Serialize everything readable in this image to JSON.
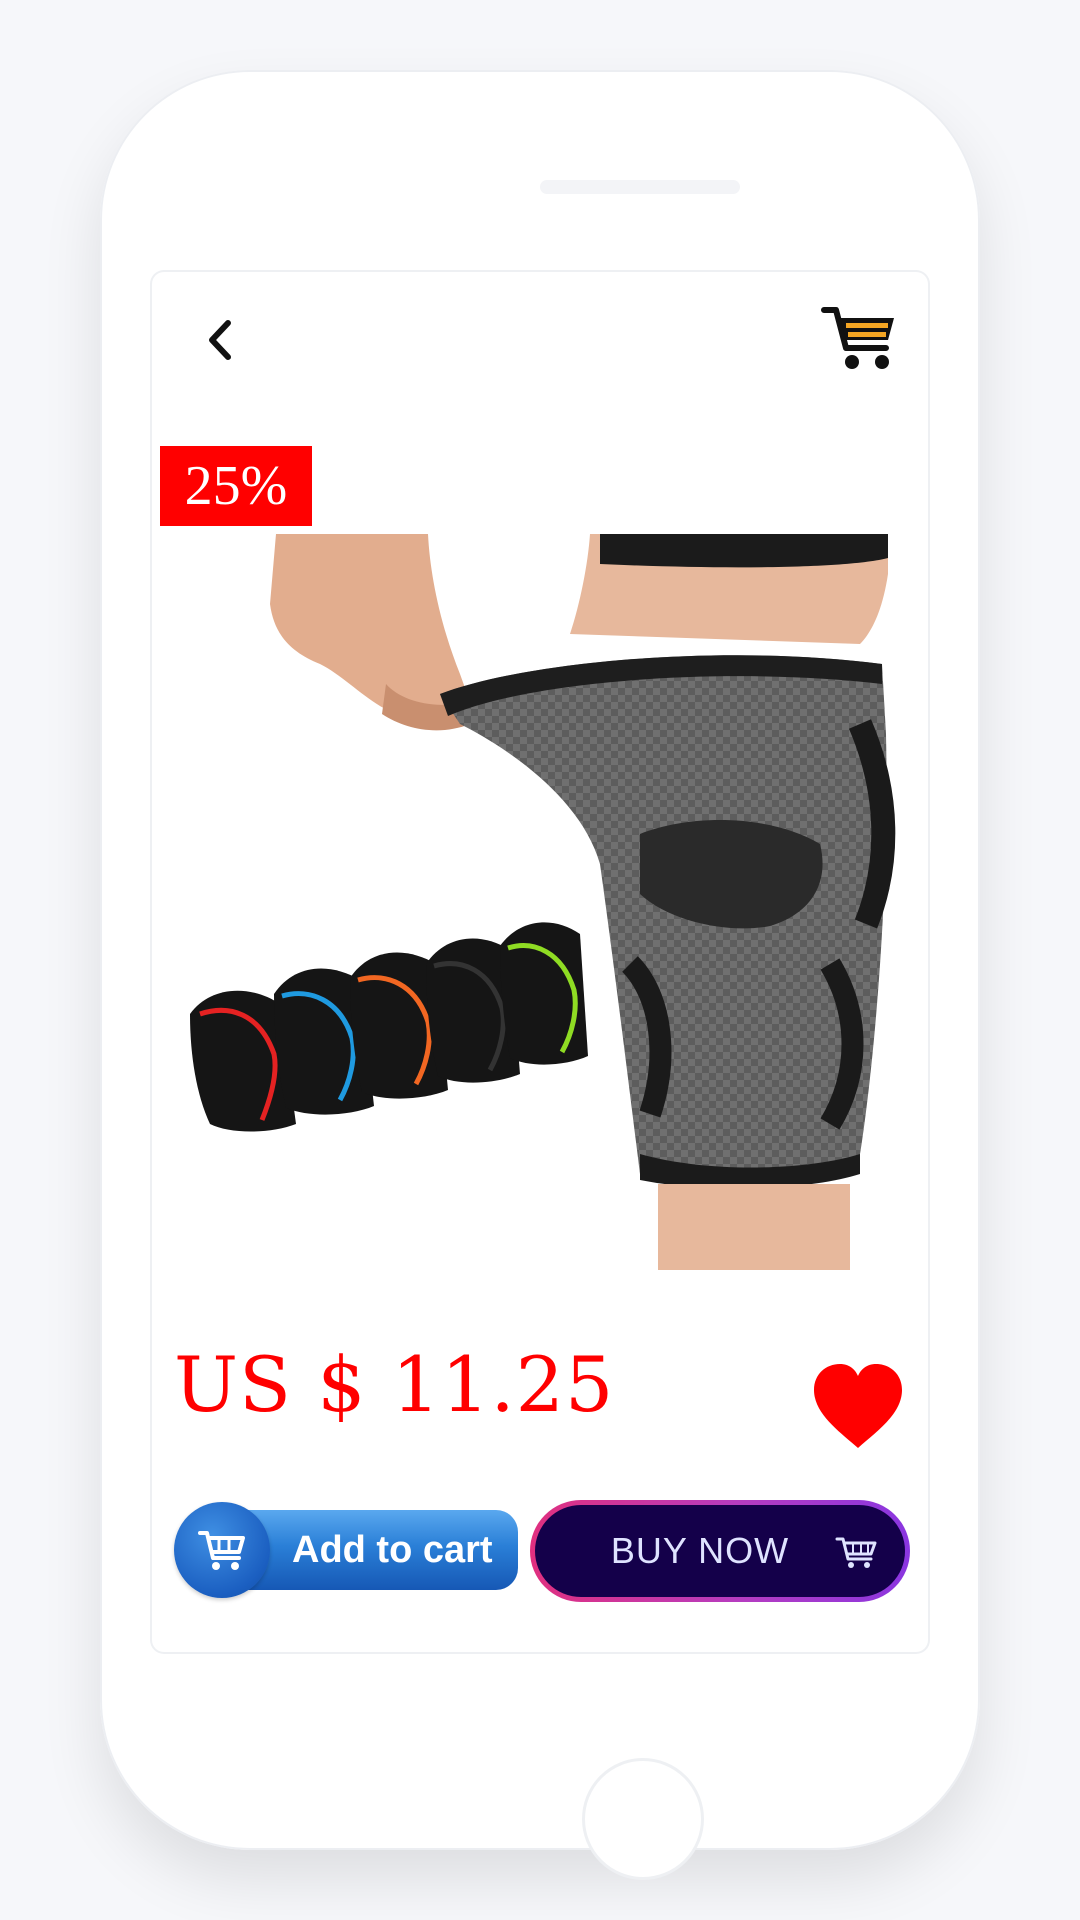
{
  "header": {
    "back_icon": "chevron-left-icon",
    "cart_icon": "shopping-cart-icon",
    "cart_accent": "#f5a623"
  },
  "product": {
    "discount_badge": "25%",
    "badge_color": "#ff0000",
    "price": "US $ 11.25",
    "price_color": "#ff0000",
    "wishlist_icon": "heart-icon",
    "image": "knee-sleeve-product-image"
  },
  "actions": {
    "add_to_cart_label": "Add to cart",
    "buy_now_label": "BUY NOW"
  }
}
